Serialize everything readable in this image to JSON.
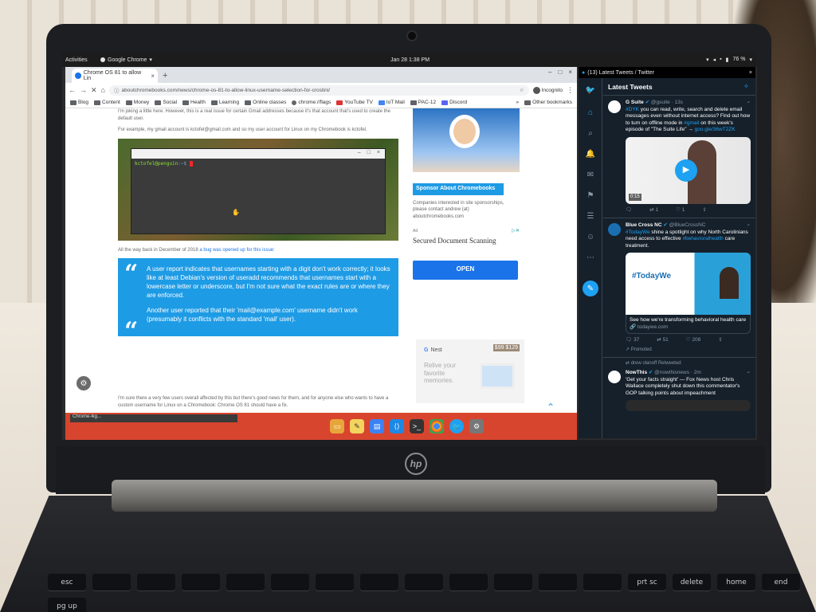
{
  "system": {
    "activities": "Activities",
    "app_name": "Google Chrome",
    "clock": "Jan 28  1:38 PM",
    "battery": "76 %"
  },
  "chrome": {
    "tab_title": "Chrome OS 81 to allow Lin",
    "url": "aboutchromebooks.com/news/chrome-os-81-to-allow-linux-username-selection-for-crostini/",
    "incognito": "Incognito",
    "bookmarks": [
      "Blog",
      "Content",
      "Money",
      "Social",
      "Health",
      "Learning",
      "Online classes",
      "chrome://flags",
      "YouTube TV",
      "IoT Mail",
      "PAC-12",
      "Discord"
    ],
    "other_bookmarks": "Other bookmarks"
  },
  "article": {
    "para1": "I'm joking a little here. However, this is a real issue for certain Gmail addresses because it's that account that's used to create the default user.",
    "para2": "For example, my gmail account is kctofel@gmail.com and so my user account for Linux on my Chromebook is kctofel.",
    "terminal_prompt_user": "kctofel@penguin",
    "terminal_prompt_path": ":~$",
    "para3_prefix": "All the way back in December of 2018 ",
    "para3_link": "a bug was opened up for this issue",
    "para3_suffix": ":",
    "quote1": "A user report indicates that usernames starting with a digit don't work correctly; it looks like at least Debian's version of useradd recommends that usernames start with a lowercase letter or underscore, but I'm not sure what the exact rules are or where they are enforced.",
    "quote2": "Another user reported that their 'mail@example.com' username didn't work (presumably it conflicts with the standard 'mail' user).",
    "para4": "I'm sure there a very few users overall affected by this but there's good news for them, and for anyone else who wants to have a custom username for Linux on a Chromebook: Chrome OS 81 should have a fix."
  },
  "sidebar": {
    "sponsor_title": "Sponsor About Chromebooks",
    "sponsor_text": "Companies interested in site sponsorships, please contact andrew (at) aboutchromebooks.com",
    "ad_flag": "Ad",
    "ad_title": "Secured Document Scanning",
    "open_label": "OPEN",
    "nest_brand": "Nest",
    "nest_tagline": "Relive your favorite memories.",
    "nest_price": "$99 $129"
  },
  "shelf": {
    "status_text": "Chrome-lkg..."
  },
  "twitter": {
    "window_title": "(13) Latest Tweets / Twitter",
    "header": "Latest Tweets",
    "tweets": [
      {
        "name": "G Suite",
        "handle": "@gsuite · 13s",
        "text_prefix": "",
        "hashtag1": "#DYK",
        "text": " you can read, write, search and delete email messages even without internet access? Find out how to turn on offline mode in ",
        "hashtag2": "#gmail",
        "text2": " on this week's episode of \"The Suite Life\" →",
        "link": "goo.gle/36wT2ZK",
        "duration": "0:15",
        "replies": "",
        "retweets": "1",
        "likes": "1"
      },
      {
        "name": "Blue Cross NC",
        "handle": "@BlueCrossNC",
        "hashtag1": "#TodayWe",
        "text": " shine a spotlight on why North Carolinians need access to effective ",
        "hashtag2": "#behavioralhealth",
        "text2": " care treatment.",
        "card_title": "See how we're transforming behavioral health care",
        "card_domain": "todaywe.com",
        "card_brand": "#TodayWe",
        "replies": "37",
        "retweets": "51",
        "likes": "208",
        "promoted": "Promoted"
      },
      {
        "retweeted_by": "drew olanoff Retweeted",
        "name": "NowThis",
        "handle": "@nowthisnews · 2m",
        "text": "'Get your facts straight' — Fox News host Chris Wallace completely shut down this commentator's GOP talking points about impeachment"
      }
    ]
  },
  "keyboard": [
    "esc",
    "",
    "",
    "",
    "",
    "",
    "",
    "",
    "",
    "",
    "",
    "",
    "",
    "prt sc",
    "delete",
    "home",
    "end",
    "pg up"
  ],
  "colors": {
    "quote_bg": "#1e9be5",
    "twitter_bg": "#15202b",
    "twitter_blue": "#1da1f2",
    "shelf": "#d8452e"
  }
}
